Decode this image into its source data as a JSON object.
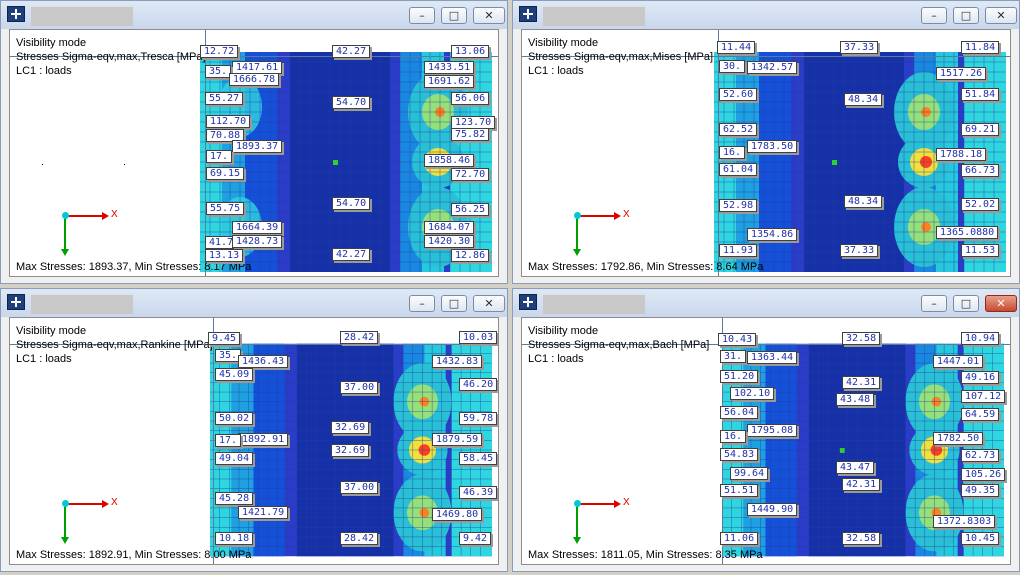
{
  "windows": [
    {
      "title_glyphs": {
        "minimize": "–",
        "maximize": "□",
        "close": "✕"
      },
      "info": {
        "line1": "Visibility mode",
        "line2": "Stresses Sigma-eqv,max,Tresca [MPa]",
        "line3": "LC1 : loads"
      },
      "status": "Max Stresses: 1893.37, Min Stresses: 8.17 MPa",
      "close_active": false,
      "axis_label": "X",
      "labels": [
        "12.72",
        "1417.61",
        "42.27",
        "13.06",
        "35.",
        "1666.78",
        "1433.51",
        "55.27",
        "1691.62",
        "56.06",
        "54.70",
        "112.70",
        "123.70",
        "70.88",
        "75.82",
        "1893.37",
        "17.",
        "1858.46",
        "69.15",
        "72.70",
        "55.75",
        "54.70",
        "56.25",
        "1664.39",
        "1684.07",
        "41.7",
        "1428.73",
        "1420.30",
        "13.13",
        "42.27",
        "12.86"
      ]
    },
    {
      "title_glyphs": {
        "minimize": "–",
        "maximize": "□",
        "close": "✕"
      },
      "info": {
        "line1": "Visibility mode",
        "line2": "Stresses Sigma-eqv,max,Mises [MPa]",
        "line3": "LC1 : loads"
      },
      "status": "Max Stresses: 1792.86, Min Stresses: 8.64 MPa",
      "close_active": false,
      "axis_label": "X",
      "labels": [
        "11.44",
        "1342.57",
        "37.33",
        "11.84",
        "30.",
        "1517.26",
        "52.60",
        "51.84",
        "48.34",
        "62.52",
        "69.21",
        "1783.50",
        "16.",
        "1788.18",
        "61.04",
        "66.73",
        "52.98",
        "48.34",
        "52.02",
        "1354.86",
        "11.93",
        "37.33",
        "1365.0880",
        "11.53"
      ]
    },
    {
      "title_glyphs": {
        "minimize": "–",
        "maximize": "□",
        "close": "✕"
      },
      "info": {
        "line1": "Visibility mode",
        "line2": "Stresses Sigma-eqv,max,Rankine [MPa]",
        "line3": "LC1 : loads"
      },
      "status": "Max Stresses: 1892.91, Min Stresses: 8.00 MPa",
      "close_active": false,
      "axis_label": "X",
      "labels": [
        "9.45",
        "28.42",
        "10.03",
        "35.",
        "1436.43",
        "1432.83",
        "45.09",
        "46.20",
        "37.00",
        "50.02",
        "59.78",
        "32.69",
        "1892.91",
        "17.",
        "1879.59",
        "32.69",
        "49.04",
        "58.45",
        "37.00",
        "46.39",
        "45.28",
        "1421.79",
        "1469.80",
        "10.18",
        "28.42",
        "9.42"
      ]
    },
    {
      "title_glyphs": {
        "minimize": "–",
        "maximize": "□",
        "close": "✕"
      },
      "info": {
        "line1": "Visibility mode",
        "line2": "Stresses Sigma-eqv,max,Bach [MPa]",
        "line3": "LC1 : loads"
      },
      "status": "Max Stresses: 1811.05, Min Stresses: 8.35 MPa",
      "close_active": true,
      "axis_label": "X",
      "labels": [
        "10.43",
        "32.58",
        "10.94",
        "31.",
        "1363.44",
        "1447.01",
        "51.20",
        "49.16",
        "42.31",
        "102.10",
        "43.48",
        "107.12",
        "56.04",
        "64.59",
        "1795.08",
        "16.",
        "1782.50",
        "54.83",
        "62.73",
        "43.47",
        "99.64",
        "105.26",
        "42.31",
        "51.51",
        "49.35",
        "1449.90",
        "1372.8303",
        "11.06",
        "32.58",
        "10.45"
      ]
    }
  ]
}
